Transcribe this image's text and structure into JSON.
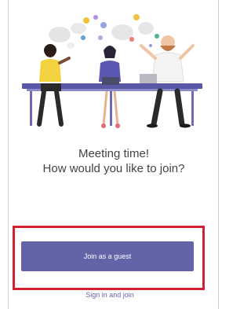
{
  "meeting": {
    "title_line1": "Meeting time!",
    "title_line2": "How would you like to join?"
  },
  "actions": {
    "join_guest_label": "Join as a guest",
    "signin_label": "Sign in and join"
  },
  "colors": {
    "accent": "#6264a7",
    "highlight_border": "#cf2330"
  },
  "illustration": {
    "icon": "meeting-people-illustration"
  }
}
